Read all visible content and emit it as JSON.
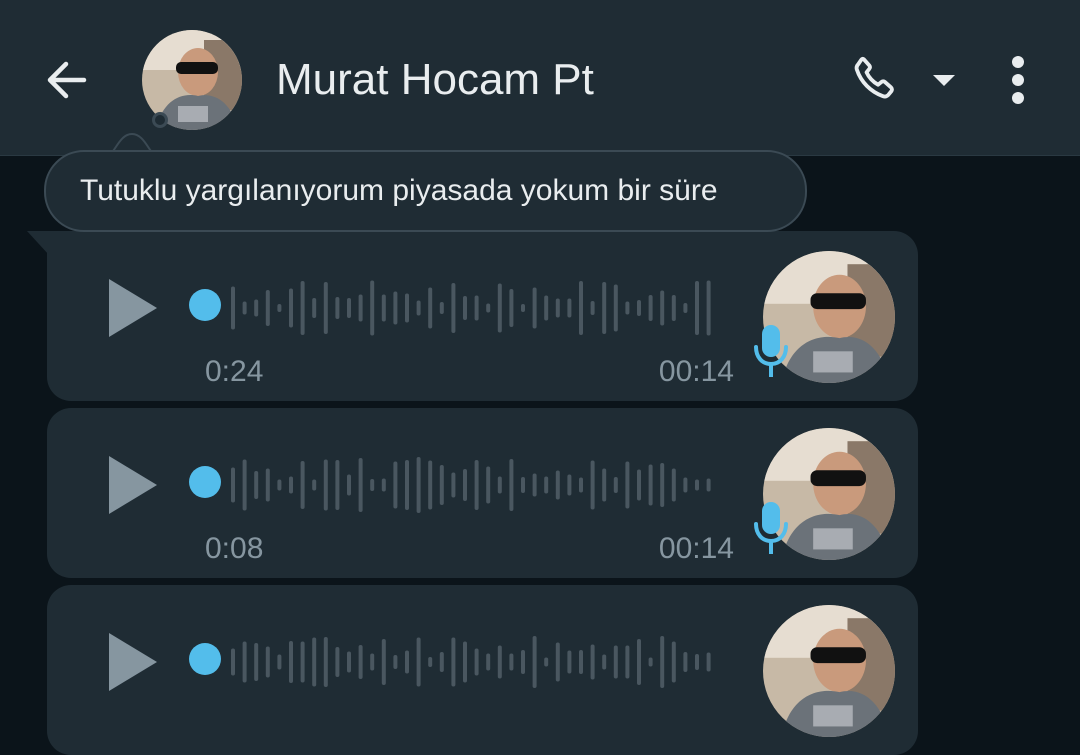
{
  "header": {
    "contact_name": "Murat Hocam Pt",
    "icons": {
      "back": "arrow-back-icon",
      "call": "phone-icon",
      "dropdown": "caret-down-icon",
      "menu": "more-vert-icon"
    }
  },
  "tooltip": {
    "text": "Tutuklu yargılanıyorum piyasada yokum bir süre"
  },
  "messages": [
    {
      "type": "voice",
      "elapsed": "0:24",
      "time": "00:14"
    },
    {
      "type": "voice",
      "elapsed": "0:08",
      "time": "00:14"
    },
    {
      "type": "voice",
      "elapsed": "",
      "time": ""
    }
  ],
  "colors": {
    "accent": "#53bdeb",
    "header_bg": "#1f2c34",
    "chat_bg": "#0b141a",
    "bubble_bg": "#1f2c34",
    "muted_text": "#8696a0"
  }
}
